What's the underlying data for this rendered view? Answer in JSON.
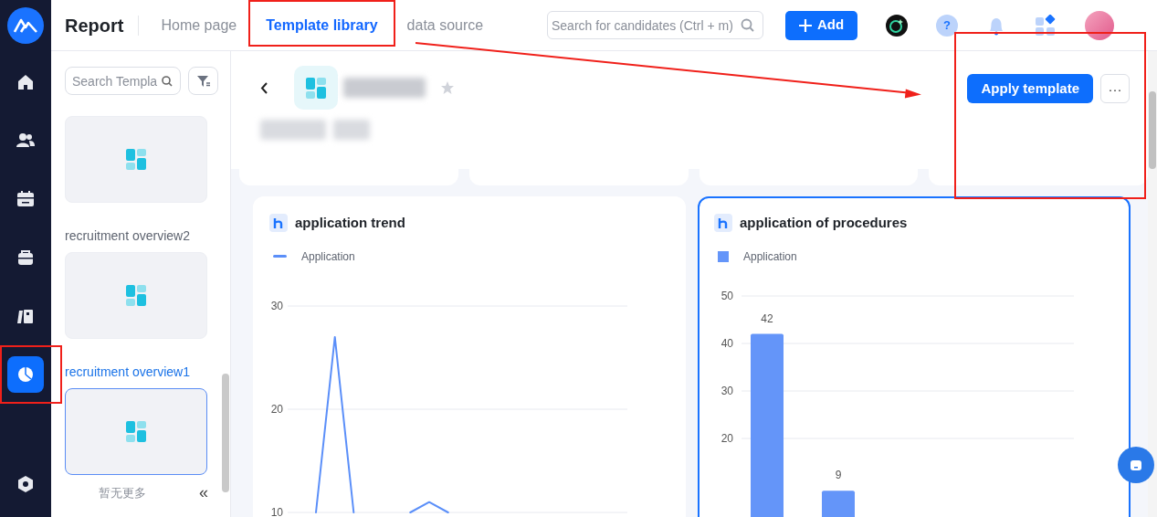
{
  "rail": {
    "items": [
      {
        "kind": "home",
        "selected": false,
        "highlighted": false
      },
      {
        "kind": "people",
        "selected": false,
        "highlighted": false
      },
      {
        "kind": "calendar",
        "selected": false,
        "highlighted": false
      },
      {
        "kind": "briefcase",
        "selected": false,
        "highlighted": false
      },
      {
        "kind": "book",
        "selected": false,
        "highlighted": false
      },
      {
        "kind": "report",
        "selected": true,
        "highlighted": true
      }
    ],
    "bottom": {
      "kind": "settings"
    }
  },
  "header": {
    "title": "Report",
    "tabs": [
      {
        "label": "Home page",
        "selected": false,
        "highlighted": false
      },
      {
        "label": "Template library",
        "selected": true,
        "highlighted": true
      },
      {
        "label": "data source",
        "selected": false,
        "highlighted": false
      }
    ],
    "search": {
      "placeholder": "Search for candidates (Ctrl + m)"
    },
    "add_button": {
      "label": "Add"
    },
    "help_button": {
      "label": "?"
    }
  },
  "template_panel": {
    "search": {
      "placeholder": "Search Templa"
    },
    "templates": [
      {
        "selected": false
      },
      {
        "name": "recruitment overview2",
        "selected": false
      },
      {
        "name": "recruitment overview1",
        "selected": true
      }
    ],
    "footer_note": "暂无更多",
    "collapse": "«"
  },
  "detail": {
    "apply_button": {
      "label": "Apply template"
    },
    "more_button": {
      "label": "···"
    },
    "actions_highlighted": true,
    "arrow": true
  },
  "charts": [
    {
      "title": "application trend",
      "selected": false,
      "chart_data": {
        "type": "line",
        "ylim": [
          10,
          30
        ],
        "yticks": [
          10,
          20,
          30
        ],
        "grid": true,
        "series": [
          {
            "name": "Application",
            "color": "#5b8ff9",
            "values": [
              null,
              10,
              27,
              10,
              null,
              null,
              10,
              11,
              10,
              null,
              null,
              null,
              null,
              null,
              null,
              null,
              null,
              null
            ]
          }
        ]
      }
    },
    {
      "title": "application of procedures",
      "selected": true,
      "chart_data": {
        "type": "bar",
        "ylim": [
          0,
          50
        ],
        "yticks": [
          20,
          30,
          40,
          50
        ],
        "grid": true,
        "series": [
          {
            "name": "Application",
            "color": "#6495f9",
            "values": [
              42,
              9
            ]
          }
        ],
        "data_labels": true
      }
    }
  ]
}
